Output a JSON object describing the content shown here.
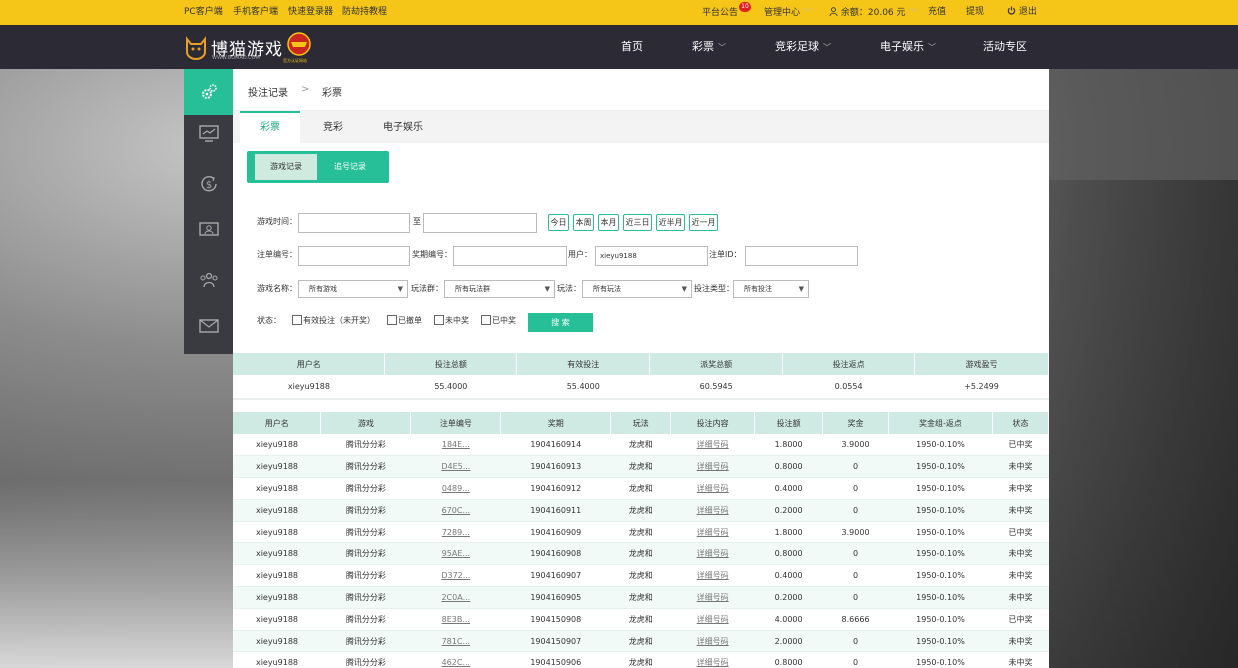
{
  "topbar": {
    "pc_client": "PC客户端",
    "mobile_client": "手机客户端",
    "speed_tester": "快速登录器",
    "anti_hijack": "防劫持教程",
    "announcement": "平台公告",
    "announcement_badge": "10",
    "member_center": "管理中心",
    "balance": "余额：20.06 元",
    "deposit": "充值",
    "withdraw": "提现",
    "logout": "退出"
  },
  "logo": {
    "brand": "博猫游戏",
    "url_text": "WWW.BOMAO.COM",
    "badge_caption": "官方认证网站"
  },
  "nav": [
    "首页",
    "彩票",
    "竞彩足球",
    "电子娱乐",
    "活动专区"
  ],
  "breadcrumb": {
    "root": "投注记录",
    "sep": ">",
    "current": "彩票"
  },
  "tabs": [
    "彩票",
    "竞彩",
    "电子娱乐"
  ],
  "subtabs": [
    "游戏记录",
    "追号记录"
  ],
  "filters": {
    "time_label": "游戏时间：",
    "to_label": "至",
    "quick": [
      "今日",
      "本周",
      "本月",
      "近三日",
      "近半月",
      "近一月"
    ],
    "order_label": "注单编号：",
    "issue_label": "奖期编号：",
    "user_label": "用户：",
    "user_value": "xieyu9188",
    "orderid_label": "注单ID：",
    "game_label": "游戏名称：",
    "game_value": "所有游戏",
    "playgroup_label": "玩法群：",
    "playgroup_value": "所有玩法群",
    "play_label": "玩法：",
    "play_value": "所有玩法",
    "bettype_label": "投注类型：",
    "bettype_value": "所有投注",
    "status_label": "状态：",
    "status_options": [
      "有效投注（未开奖）",
      "已撤单",
      "未中奖",
      "已中奖"
    ],
    "search": "搜 索"
  },
  "summary": {
    "headers": [
      "用户名",
      "投注总额",
      "有效投注",
      "派奖总额",
      "投注返点",
      "游戏盈亏"
    ],
    "row": [
      "xieyu9188",
      "55.4000",
      "55.4000",
      "60.5945",
      "0.0554",
      "+5.2499"
    ]
  },
  "records": {
    "headers": [
      "用户名",
      "游戏",
      "注单编号",
      "奖期",
      "玩法",
      "投注内容",
      "投注额",
      "奖金",
      "奖金组-返点",
      "状态"
    ],
    "rows": [
      [
        "xieyu9188",
        "腾讯分分彩",
        "184E...",
        "1904160914",
        "龙虎和",
        "详细号码",
        "1.8000",
        "3.9000",
        "1950-0.10%",
        "已中奖"
      ],
      [
        "xieyu9188",
        "腾讯分分彩",
        "D4E5...",
        "1904160913",
        "龙虎和",
        "详细号码",
        "0.8000",
        "0",
        "1950-0.10%",
        "未中奖"
      ],
      [
        "xieyu9188",
        "腾讯分分彩",
        "0489...",
        "1904160912",
        "龙虎和",
        "详细号码",
        "0.4000",
        "0",
        "1950-0.10%",
        "未中奖"
      ],
      [
        "xieyu9188",
        "腾讯分分彩",
        "670C...",
        "1904160911",
        "龙虎和",
        "详细号码",
        "0.2000",
        "0",
        "1950-0.10%",
        "未中奖"
      ],
      [
        "xieyu9188",
        "腾讯分分彩",
        "7289...",
        "1904160909",
        "龙虎和",
        "详细号码",
        "1.8000",
        "3.9000",
        "1950-0.10%",
        "已中奖"
      ],
      [
        "xieyu9188",
        "腾讯分分彩",
        "95AE...",
        "1904160908",
        "龙虎和",
        "详细号码",
        "0.8000",
        "0",
        "1950-0.10%",
        "未中奖"
      ],
      [
        "xieyu9188",
        "腾讯分分彩",
        "D372...",
        "1904160907",
        "龙虎和",
        "详细号码",
        "0.4000",
        "0",
        "1950-0.10%",
        "未中奖"
      ],
      [
        "xieyu9188",
        "腾讯分分彩",
        "2C0A...",
        "1904160905",
        "龙虎和",
        "详细号码",
        "0.2000",
        "0",
        "1950-0.10%",
        "未中奖"
      ],
      [
        "xieyu9188",
        "腾讯分分彩",
        "8E3B...",
        "1904150908",
        "龙虎和",
        "详细号码",
        "4.0000",
        "8.6666",
        "1950-0.10%",
        "已中奖"
      ],
      [
        "xieyu9188",
        "腾讯分分彩",
        "781C...",
        "1904150907",
        "龙虎和",
        "详细号码",
        "2.0000",
        "0",
        "1950-0.10%",
        "未中奖"
      ],
      [
        "xieyu9188",
        "腾讯分分彩",
        "462C...",
        "1904150906",
        "龙虎和",
        "详细号码",
        "0.8000",
        "0",
        "1950-0.10%",
        "未中奖"
      ]
    ]
  },
  "colors": {
    "accent": "#26bf97",
    "topbar": "#f5c518",
    "nav": "#2b2a35",
    "sidenav": "#3a3a41"
  }
}
